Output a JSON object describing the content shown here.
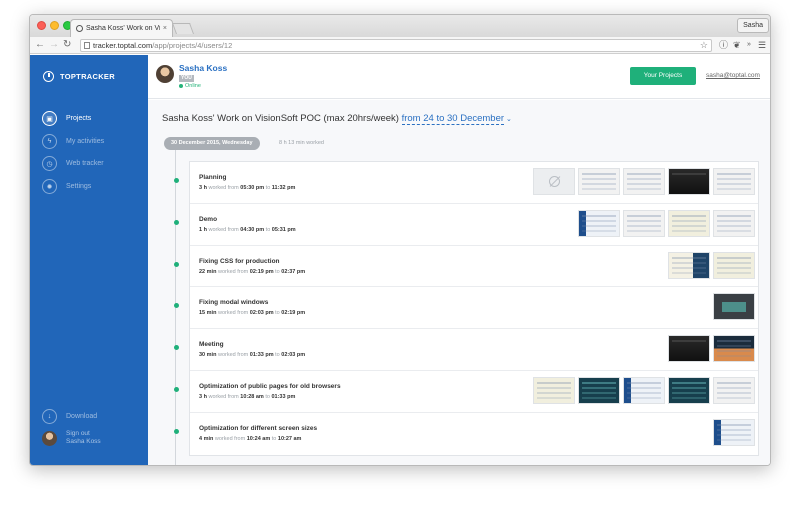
{
  "browser": {
    "tab_title": "Sasha Koss' Work on Visio",
    "tab_close": "×",
    "profile_name": "Sasha",
    "url_host": "tracker.toptal.com",
    "url_path": "/app/projects/4/users/12"
  },
  "sidebar": {
    "brand": "TOPTRACKER",
    "items": [
      {
        "label": "Projects",
        "icon": "briefcase-icon"
      },
      {
        "label": "My activities",
        "icon": "bolt-icon"
      },
      {
        "label": "Web tracker",
        "icon": "stopwatch-icon"
      },
      {
        "label": "Settings",
        "icon": "gear-icon"
      }
    ],
    "download_label": "Download",
    "signout_label": "Sign out",
    "signout_user": "Sasha Koss"
  },
  "header": {
    "user_name": "Sasha Koss",
    "you_badge": "YOU",
    "status": "Online",
    "projects_button": "Your Projects",
    "email": "sasha@toptal.com"
  },
  "page": {
    "title": "Sasha Koss' Work on VisionSoft POC (max 20hrs/week)",
    "range": "from 24 to 30 December",
    "date": "30 December 2015, Wednesday",
    "date_worked": "8 h 13 min worked"
  },
  "labels": {
    "worked_from": "worked from",
    "to": "to"
  },
  "activities": [
    {
      "name": "Planning",
      "duration": "3 h",
      "from": "05:30 pm",
      "to": "11:32 pm",
      "thumbs": [
        "empty",
        "light",
        "light",
        "dark",
        "light"
      ]
    },
    {
      "name": "Demo",
      "duration": "1 h",
      "from": "04:30 pm",
      "to": "05:31 pm",
      "thumbs": [
        "blue",
        "light",
        "yellow",
        "light"
      ]
    },
    {
      "name": "Fixing CSS for production",
      "duration": "22 min",
      "from": "02:19 pm",
      "to": "02:37 pm",
      "thumbs": [
        "code",
        "yellow"
      ]
    },
    {
      "name": "Fixing modal windows",
      "duration": "15 min",
      "from": "02:03 pm",
      "to": "02:19 pm",
      "thumbs": [
        "modal"
      ]
    },
    {
      "name": "Meeting",
      "duration": "30 min",
      "from": "01:33 pm",
      "to": "02:03 pm",
      "thumbs": [
        "dark",
        "orange"
      ]
    },
    {
      "name": "Optimization of public pages for old browsers",
      "duration": "3 h",
      "from": "10:28 am",
      "to": "01:33 pm",
      "thumbs": [
        "yellow",
        "teal",
        "blue",
        "teal",
        "light"
      ]
    },
    {
      "name": "Optimization for different screen sizes",
      "duration": "4 min",
      "from": "10:24 am",
      "to": "10:27 am",
      "thumbs": [
        "blue"
      ]
    }
  ]
}
